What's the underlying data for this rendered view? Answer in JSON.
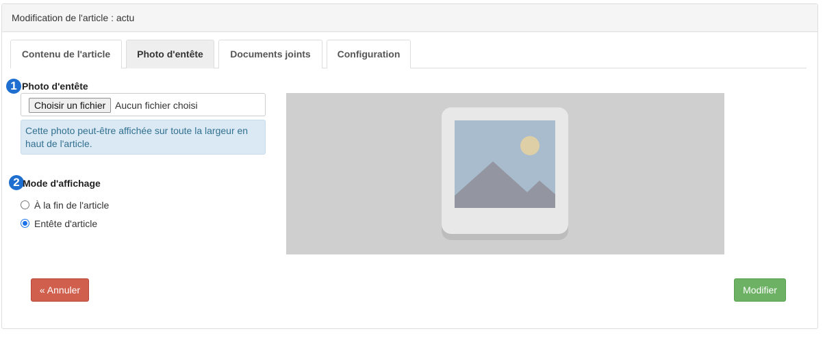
{
  "panel": {
    "title": "Modification de l'article : actu"
  },
  "tabs": [
    {
      "label": "Contenu de l'article",
      "active": false
    },
    {
      "label": "Photo d'entête",
      "active": true
    },
    {
      "label": "Documents joints",
      "active": false
    },
    {
      "label": "Configuration",
      "active": false
    }
  ],
  "photo_section": {
    "step": "1",
    "label": "Photo d'entête",
    "file_button_label": "Choisir un fichier",
    "file_status": "Aucun fichier choisi",
    "help_text": "Cette photo peut-être affichée sur toute la largeur en haut de l'article."
  },
  "display_section": {
    "step": "2",
    "label": "Mode d'affichage",
    "options": [
      {
        "label": "À la fin de l'article",
        "checked": false
      },
      {
        "label": "Entête d'article",
        "checked": true
      }
    ]
  },
  "preview": {
    "icon": "image-placeholder-icon"
  },
  "actions": {
    "cancel_label": "« Annuler",
    "submit_label": "Modifier"
  },
  "colors": {
    "step_badge": "#1f6fd1",
    "cancel_button": "#d05f4e",
    "submit_button": "#6db165",
    "help_background": "#dbe9f5",
    "preview_background": "#cfcfcf"
  }
}
